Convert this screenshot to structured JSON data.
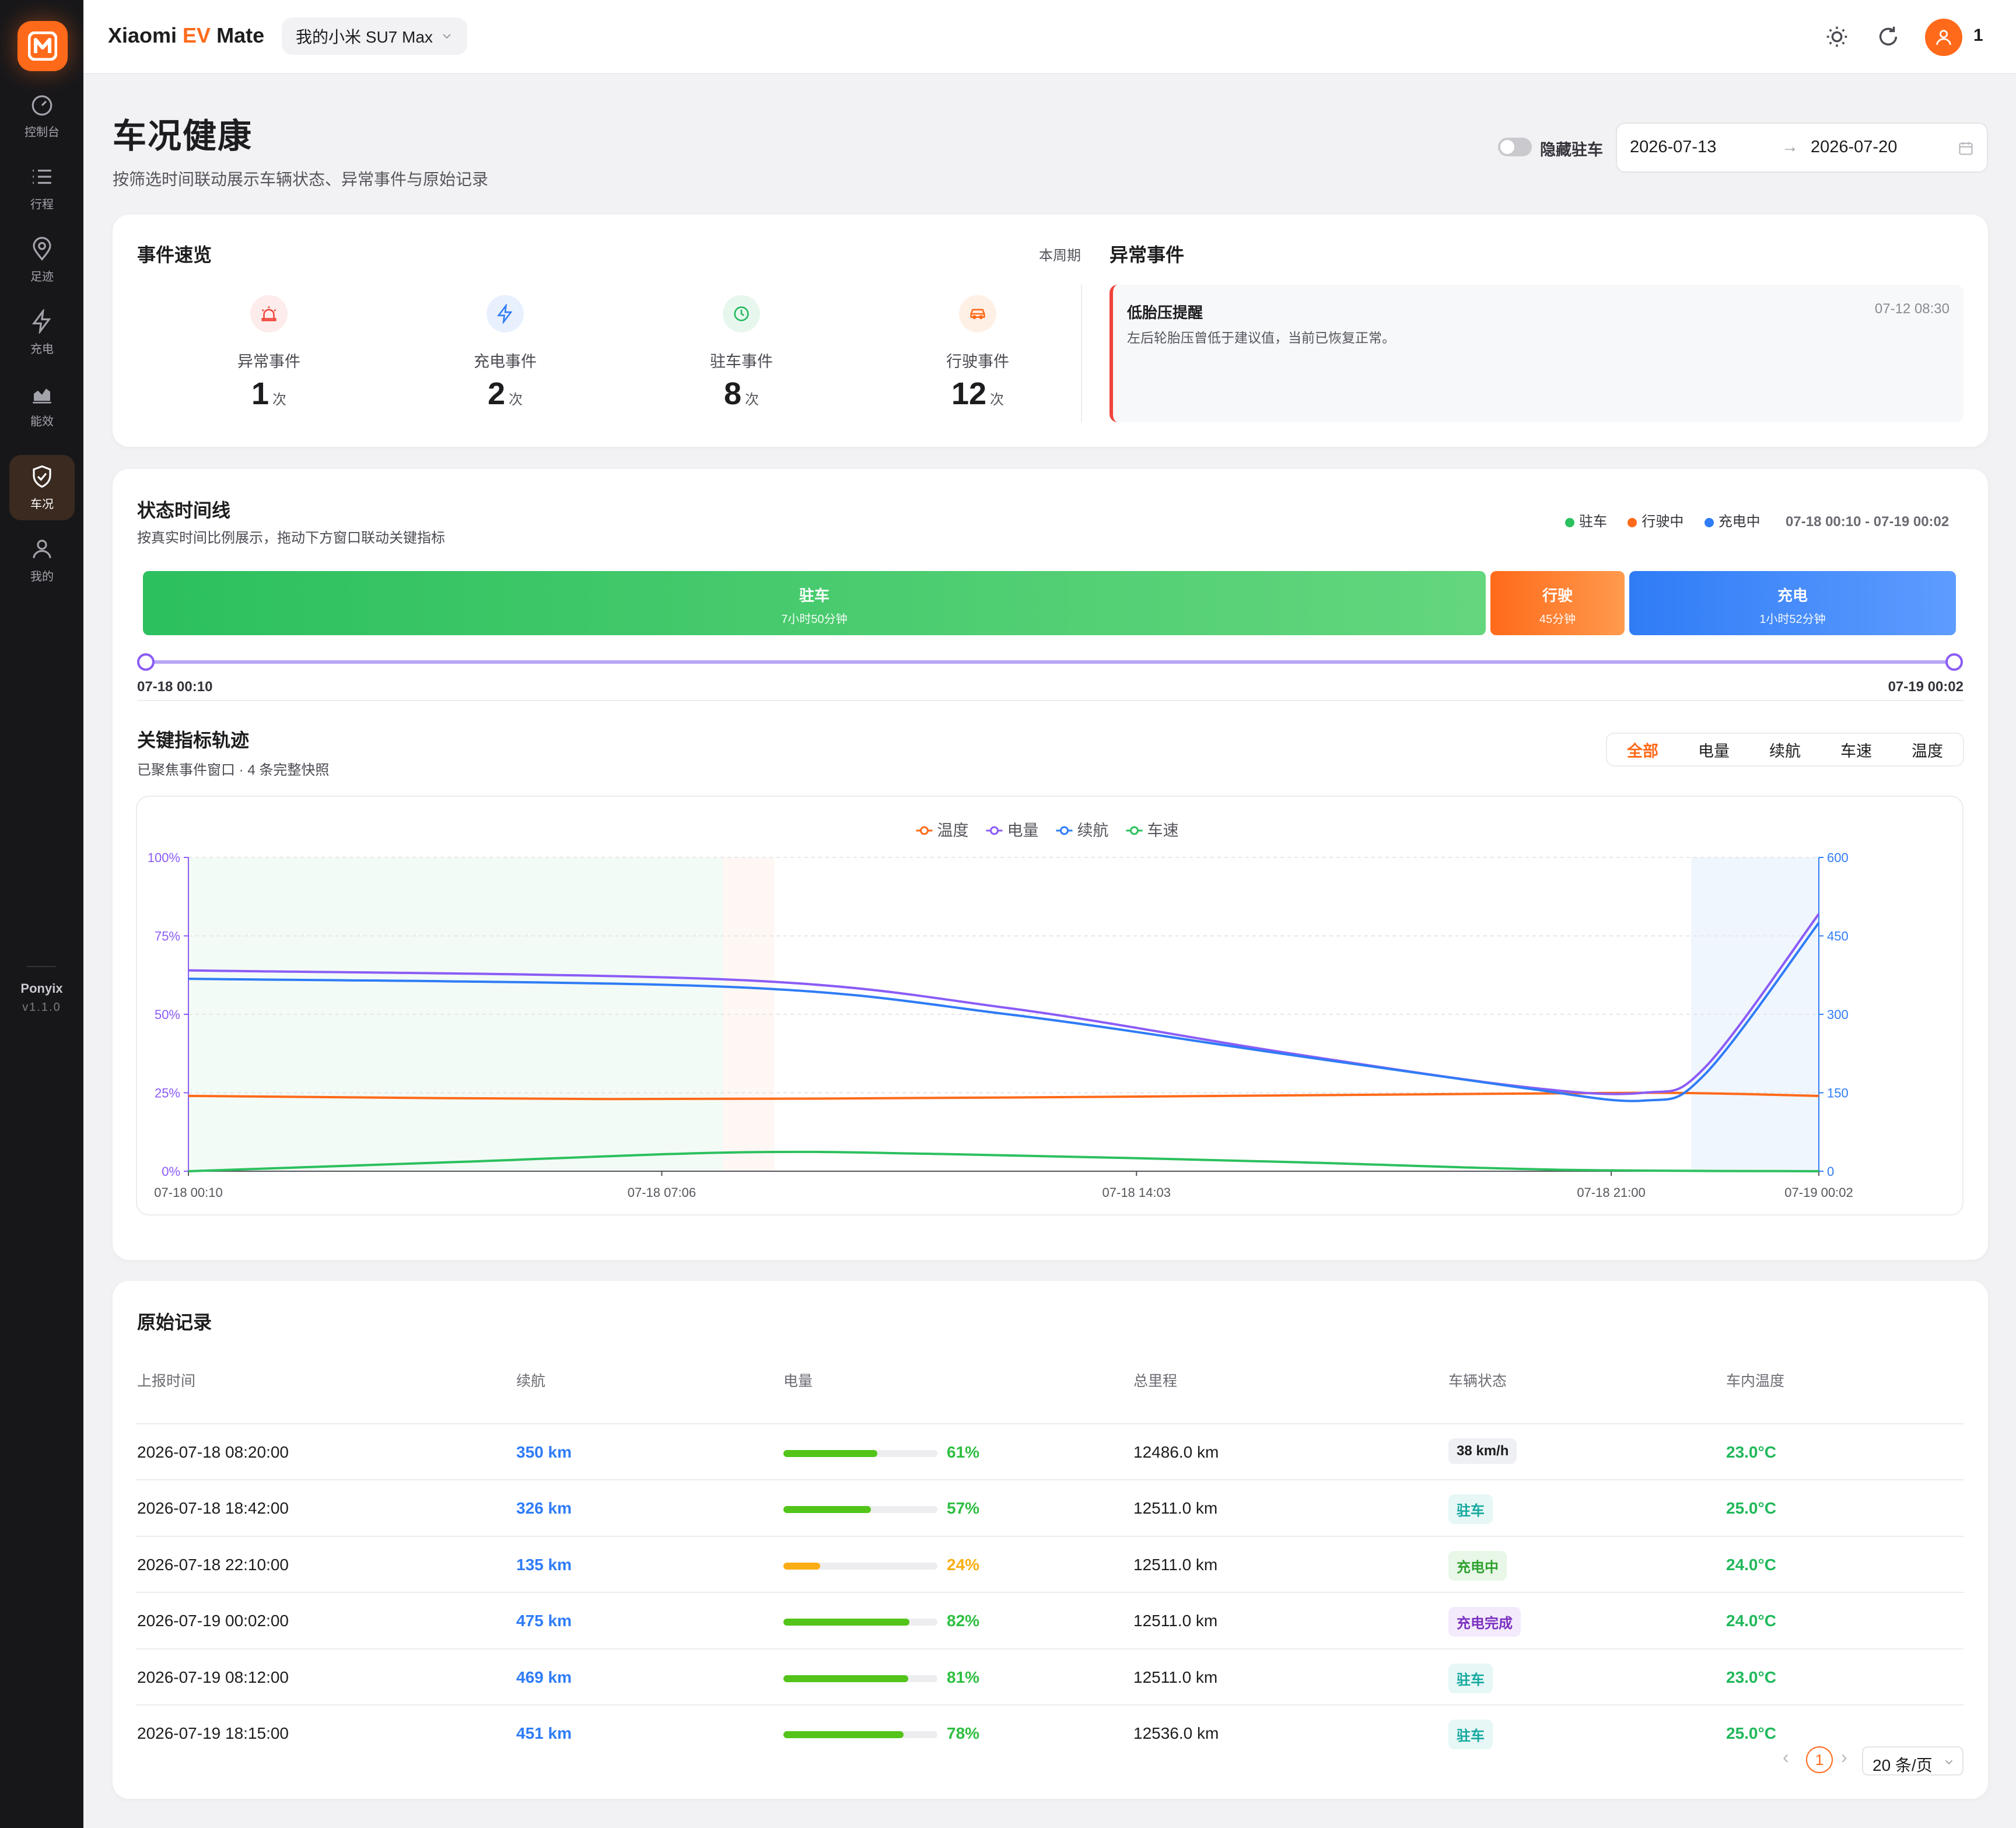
{
  "app": {
    "title_pre": "Xiaomi ",
    "title_accent": "EV",
    "title_post": " Mate",
    "vehicle": "我的小米 SU7 Max",
    "user_count": "1",
    "accent_color": "#ff6a1a"
  },
  "sidebar": {
    "items": [
      {
        "label": "控制台",
        "icon": "dashboard-icon"
      },
      {
        "label": "行程",
        "icon": "list-icon"
      },
      {
        "label": "足迹",
        "icon": "location-pin-icon"
      },
      {
        "label": "充电",
        "icon": "lightning-icon"
      },
      {
        "label": "能效",
        "icon": "bar-chart-icon"
      },
      {
        "label": "车况",
        "icon": "shield-check-icon",
        "active": true
      },
      {
        "label": "我的",
        "icon": "user-icon"
      }
    ],
    "brand": "Ponyix",
    "version": "v1.1.0"
  },
  "page": {
    "title": "车况健康",
    "subtitle": "按筛选时间联动展示车辆状态、异常事件与原始记录",
    "hide_parking_label": "隐藏驻车",
    "date_from": "2026-07-13",
    "date_to": "2026-07-20",
    "date_arrow": "→"
  },
  "events": {
    "title": "事件速览",
    "period": "本周期",
    "unit": "次",
    "stats": [
      {
        "label": "异常事件",
        "value": "1",
        "icon": "alarm-icon",
        "color": "#f0443a"
      },
      {
        "label": "充电事件",
        "value": "2",
        "icon": "lightning-icon",
        "color": "#2f7cf6"
      },
      {
        "label": "驻车事件",
        "value": "8",
        "icon": "clock-icon",
        "color": "#20b85a"
      },
      {
        "label": "行驶事件",
        "value": "12",
        "icon": "car-icon",
        "color": "#ff6a1a"
      }
    ],
    "abnormal_title": "异常事件",
    "alert": {
      "title": "低胎压提醒",
      "desc": "左后轮胎压曾低于建议值，当前已恢复正常。",
      "time": "07-12 08:30"
    }
  },
  "timeline": {
    "title": "状态时间线",
    "subtitle": "按真实时间比例展示，拖动下方窗口联动关键指标",
    "legend": [
      {
        "label": "驻车",
        "color": "#2cc05e"
      },
      {
        "label": "行驶中",
        "color": "#ff6a1a"
      },
      {
        "label": "充电中",
        "color": "#2f7cf6"
      }
    ],
    "range": "07-18 00:10 - 07-19 00:02",
    "segments": [
      {
        "name": "驻车",
        "duration": "7小时50分钟"
      },
      {
        "name": "行驶",
        "duration": "45分钟"
      },
      {
        "name": "充电",
        "duration": "1小时52分钟"
      }
    ],
    "start": "07-18 00:10",
    "end": "07-19 00:02"
  },
  "metrics": {
    "title": "关键指标轨迹",
    "subtitle": "已聚焦事件窗口 · 4 条完整快照",
    "tabs": [
      "全部",
      "电量",
      "续航",
      "车速",
      "温度"
    ],
    "active_tab": "全部"
  },
  "chart_data": {
    "type": "line",
    "legend": [
      "温度",
      "电量",
      "续航",
      "车速"
    ],
    "x": [
      "07-18 00:10",
      "07-18 07:06",
      "07-18 14:03",
      "07-18 21:00",
      "07-19 00:02"
    ],
    "y_left_ticks": [
      "0%",
      "25%",
      "50%",
      "75%",
      "100%"
    ],
    "y_right_ticks": [
      "0",
      "150",
      "300",
      "450",
      "600"
    ],
    "ylim_left": [
      0,
      100
    ],
    "ylim_right": [
      0,
      600
    ],
    "x_hours": [
      0,
      6.93,
      13.88,
      20.83,
      23.87
    ],
    "series": [
      {
        "name": "温度",
        "axis": "left",
        "color": "#ff6a1a",
        "points": [
          [
            0,
            24
          ],
          [
            6.2,
            23
          ],
          [
            12,
            23.5
          ],
          [
            18,
            24.5
          ],
          [
            21.5,
            25
          ],
          [
            23.87,
            24
          ]
        ]
      },
      {
        "name": "电量",
        "axis": "left",
        "color": "#8b5cf6",
        "points": [
          [
            0,
            64
          ],
          [
            8,
            61
          ],
          [
            12,
            52
          ],
          [
            16,
            38
          ],
          [
            19.5,
            27
          ],
          [
            21.3,
            25
          ],
          [
            22.2,
            33
          ],
          [
            23.87,
            82
          ]
        ]
      },
      {
        "name": "续航",
        "axis": "right",
        "color": "#2f7cf6",
        "points": [
          [
            0,
            368
          ],
          [
            8,
            352
          ],
          [
            12,
            300
          ],
          [
            16,
            225
          ],
          [
            19.5,
            160
          ],
          [
            21.3,
            135
          ],
          [
            22.2,
            185
          ],
          [
            23.87,
            475
          ]
        ]
      },
      {
        "name": "车速",
        "axis": "left",
        "color": "#2cc05e",
        "points": [
          [
            0,
            0
          ],
          [
            4,
            3
          ],
          [
            8,
            6
          ],
          [
            11,
            5.5
          ],
          [
            16,
            3
          ],
          [
            20,
            0.5
          ],
          [
            23.87,
            0
          ]
        ]
      }
    ],
    "bands": [
      {
        "from": 0,
        "to": 7.83,
        "color": "rgba(44,192,94,0.06)"
      },
      {
        "from": 7.83,
        "to": 8.58,
        "color": "rgba(255,106,26,0.05)"
      },
      {
        "from": 22,
        "to": 23.87,
        "color": "rgba(47,124,246,0.07)"
      }
    ]
  },
  "records": {
    "title": "原始记录",
    "columns": [
      "上报时间",
      "续航",
      "电量",
      "总里程",
      "车辆状态",
      "车内温度"
    ],
    "rows": [
      {
        "time": "2026-07-18 08:20:00",
        "range": "350 km",
        "battery": 61,
        "battery_text": "61%",
        "odo": "12486.0 km",
        "status": "38 km/h",
        "status_kind": "speed",
        "temp": "23.0°C"
      },
      {
        "time": "2026-07-18 18:42:00",
        "range": "326 km",
        "battery": 57,
        "battery_text": "57%",
        "odo": "12511.0 km",
        "status": "驻车",
        "status_kind": "park",
        "temp": "25.0°C"
      },
      {
        "time": "2026-07-18 22:10:00",
        "range": "135 km",
        "battery": 24,
        "battery_text": "24%",
        "odo": "12511.0 km",
        "status": "充电中",
        "status_kind": "charging",
        "temp": "24.0°C"
      },
      {
        "time": "2026-07-19 00:02:00",
        "range": "475 km",
        "battery": 82,
        "battery_text": "82%",
        "odo": "12511.0 km",
        "status": "充电完成",
        "status_kind": "charged",
        "temp": "24.0°C"
      },
      {
        "time": "2026-07-19 08:12:00",
        "range": "469 km",
        "battery": 81,
        "battery_text": "81%",
        "odo": "12511.0 km",
        "status": "驻车",
        "status_kind": "park",
        "temp": "23.0°C"
      },
      {
        "time": "2026-07-19 18:15:00",
        "range": "451 km",
        "battery": 78,
        "battery_text": "78%",
        "odo": "12536.0 km",
        "status": "驻车",
        "status_kind": "park",
        "temp": "25.0°C"
      }
    ],
    "page": "1",
    "page_size": "20 条/页"
  }
}
